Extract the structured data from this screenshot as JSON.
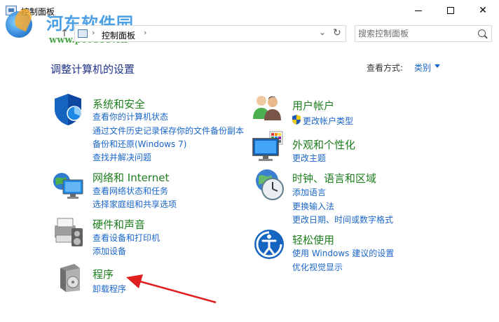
{
  "window": {
    "title": "控制面板"
  },
  "watermark": {
    "text": "河东软件园",
    "url": "www.pc0359.cn"
  },
  "address": {
    "breadcrumb": "控制面板",
    "search_placeholder": "搜索控制面板"
  },
  "header": {
    "title": "调整计算机的设置",
    "view_by_label": "查看方式:",
    "view_by_value": "类别"
  },
  "categories": {
    "system_security": {
      "title": "系统和安全",
      "links": [
        "查看你的计算机状态",
        "通过文件历史记录保存你的文件备份副本",
        "备份和还原(Windows 7)",
        "查找并解决问题"
      ]
    },
    "network": {
      "title": "网络和 Internet",
      "links": [
        "查看网络状态和任务",
        "选择家庭组和共享选项"
      ]
    },
    "hardware": {
      "title": "硬件和声音",
      "links": [
        "查看设备和打印机",
        "添加设备"
      ]
    },
    "programs": {
      "title": "程序",
      "links": [
        "卸载程序"
      ]
    },
    "user_accounts": {
      "title": "用户帐户",
      "links": [
        "更改帐户类型"
      ]
    },
    "appearance": {
      "title": "外观和个性化",
      "links": [
        "更改主题"
      ]
    },
    "clock_region": {
      "title": "时钟、语言和区域",
      "links": [
        "添加语言",
        "更换输入法",
        "更改日期、时间或数字格式"
      ]
    },
    "ease_access": {
      "title": "轻松使用",
      "links": [
        "使用 Windows 建议的设置",
        "优化视觉显示"
      ]
    }
  },
  "colors": {
    "category_green": "#1e7d1e",
    "link_blue": "#1a66c9",
    "title_navy": "#1e3287",
    "annotation_red": "#e02020"
  }
}
